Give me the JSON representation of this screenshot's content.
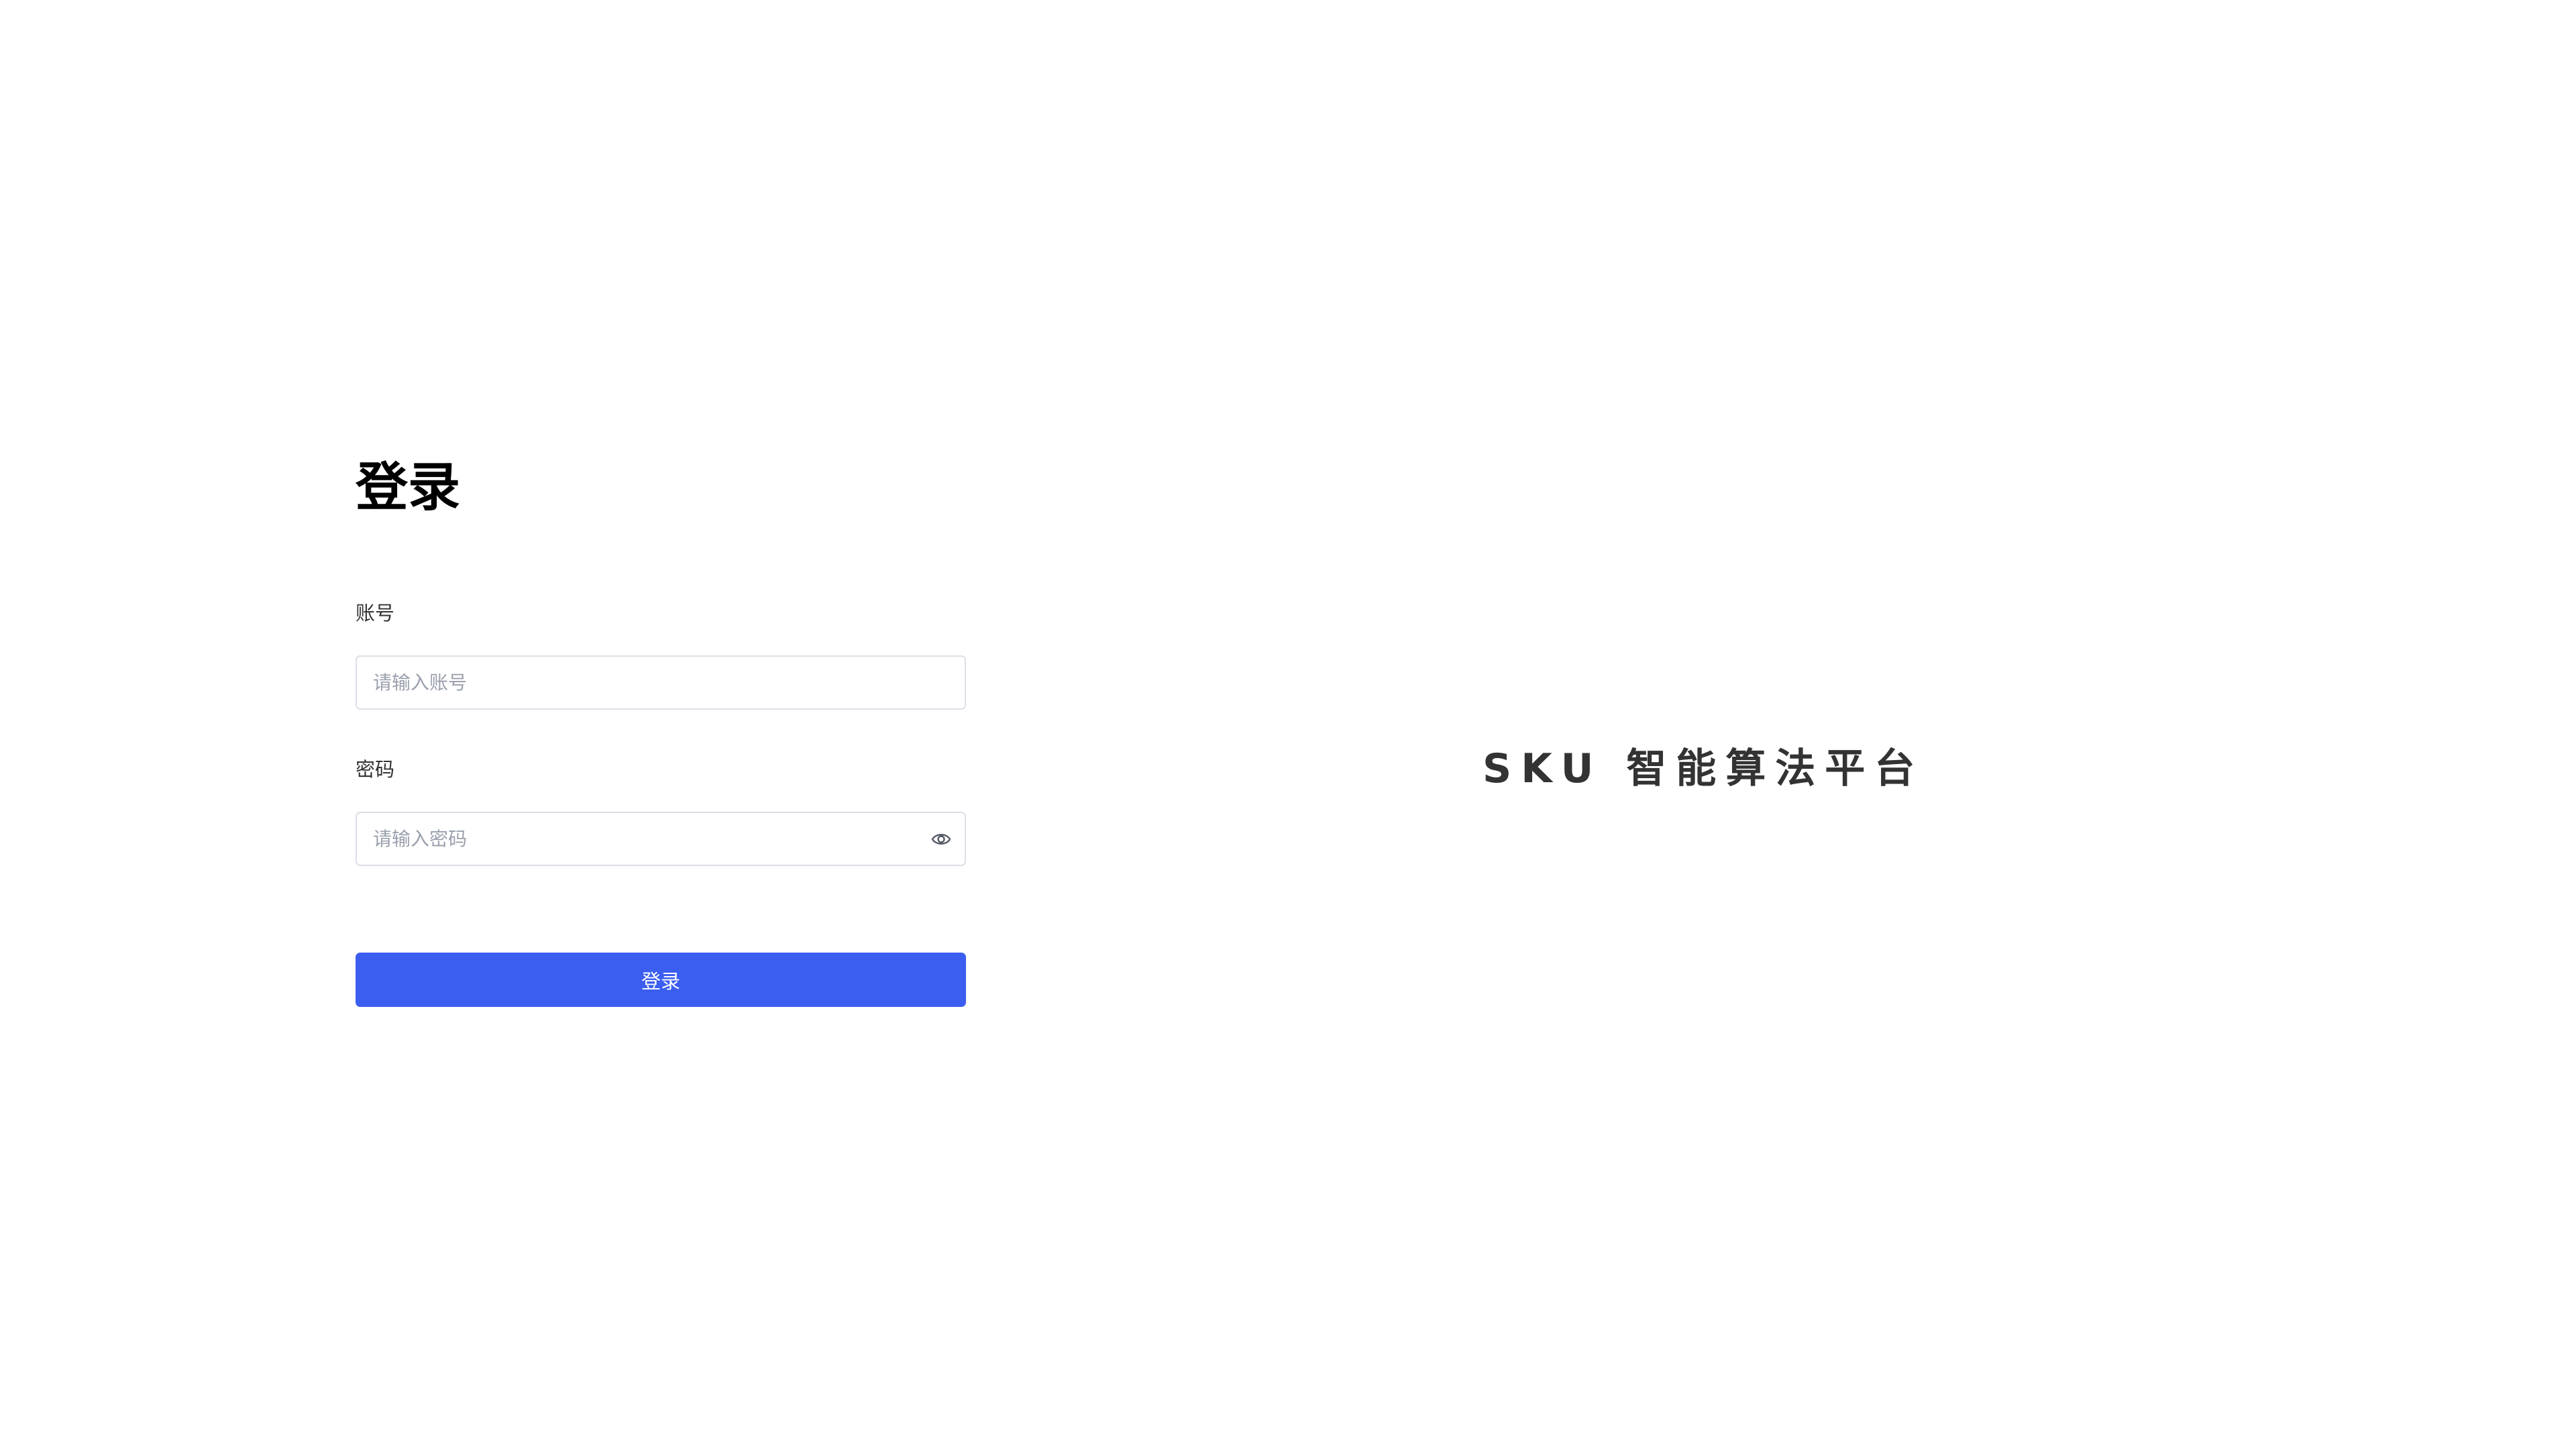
{
  "login": {
    "title": "登录",
    "account_label": "账号",
    "account_placeholder": "请输入账号",
    "password_label": "密码",
    "password_placeholder": "请输入密码",
    "password_toggle_icon": "eye-icon",
    "submit_label": "登录"
  },
  "brand": {
    "name": "SKU 智能算法平台"
  },
  "colors": {
    "primary": "#3b5ef0",
    "input_border": "#dcdfe6",
    "placeholder": "#9aa1ad",
    "brand_text": "#333333"
  }
}
